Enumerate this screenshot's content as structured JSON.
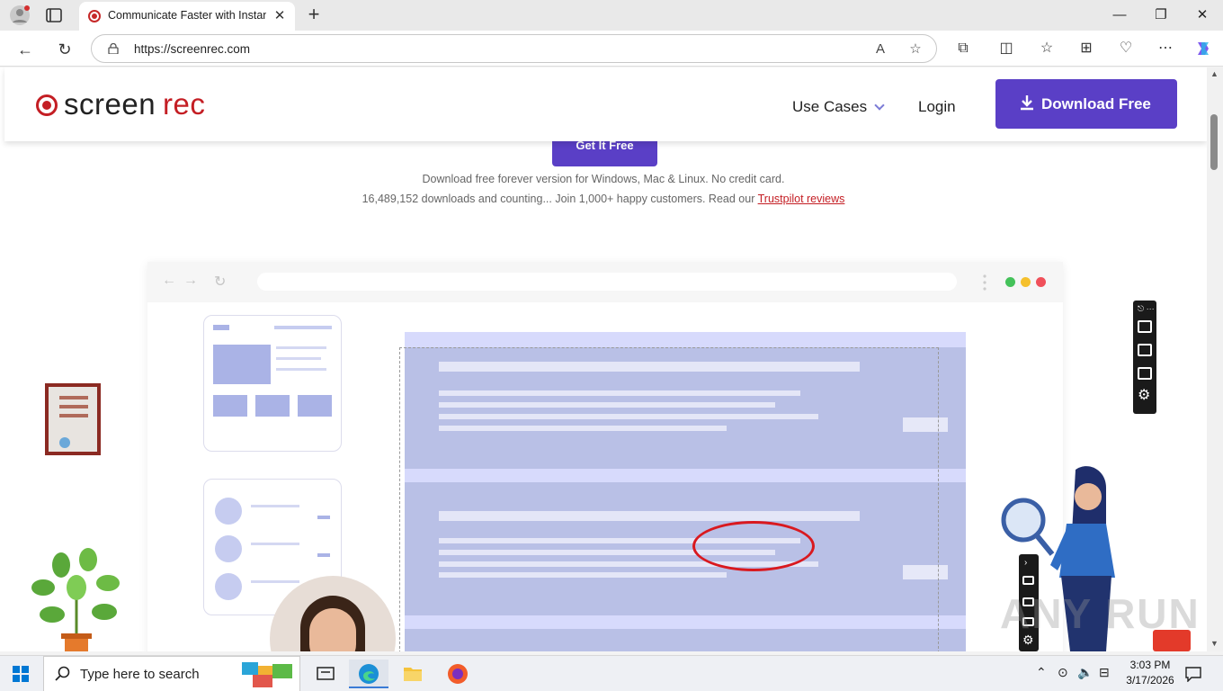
{
  "browser": {
    "tab_title": "Communicate Faster with Instant",
    "tab_close": "✕",
    "new_tab": "+",
    "url": "https://screenrec.com",
    "window_controls": {
      "minimize": "—",
      "maximize": "❐",
      "close": "✕"
    }
  },
  "site": {
    "logo_left": "screen",
    "logo_right": "rec",
    "nav": {
      "use_cases": "Use Cases",
      "login": "Login"
    },
    "download_button": "Download Free",
    "cta_button": "Get It Free",
    "subline1": "Download free forever version for Windows, Mac & Linux. No credit card.",
    "subline2_prefix": "16,489,152 downloads and counting... Join 1,000+ happy customers. Read our ",
    "subline2_link": "Trustpilot reviews",
    "watermark": "ANY RUN"
  },
  "colors": {
    "brand_red": "#c41e24",
    "brand_purple": "#5a3fc6"
  },
  "taskbar": {
    "search_placeholder": "Type here to search",
    "time": "3:03 PM",
    "date": "3/17/2026"
  }
}
